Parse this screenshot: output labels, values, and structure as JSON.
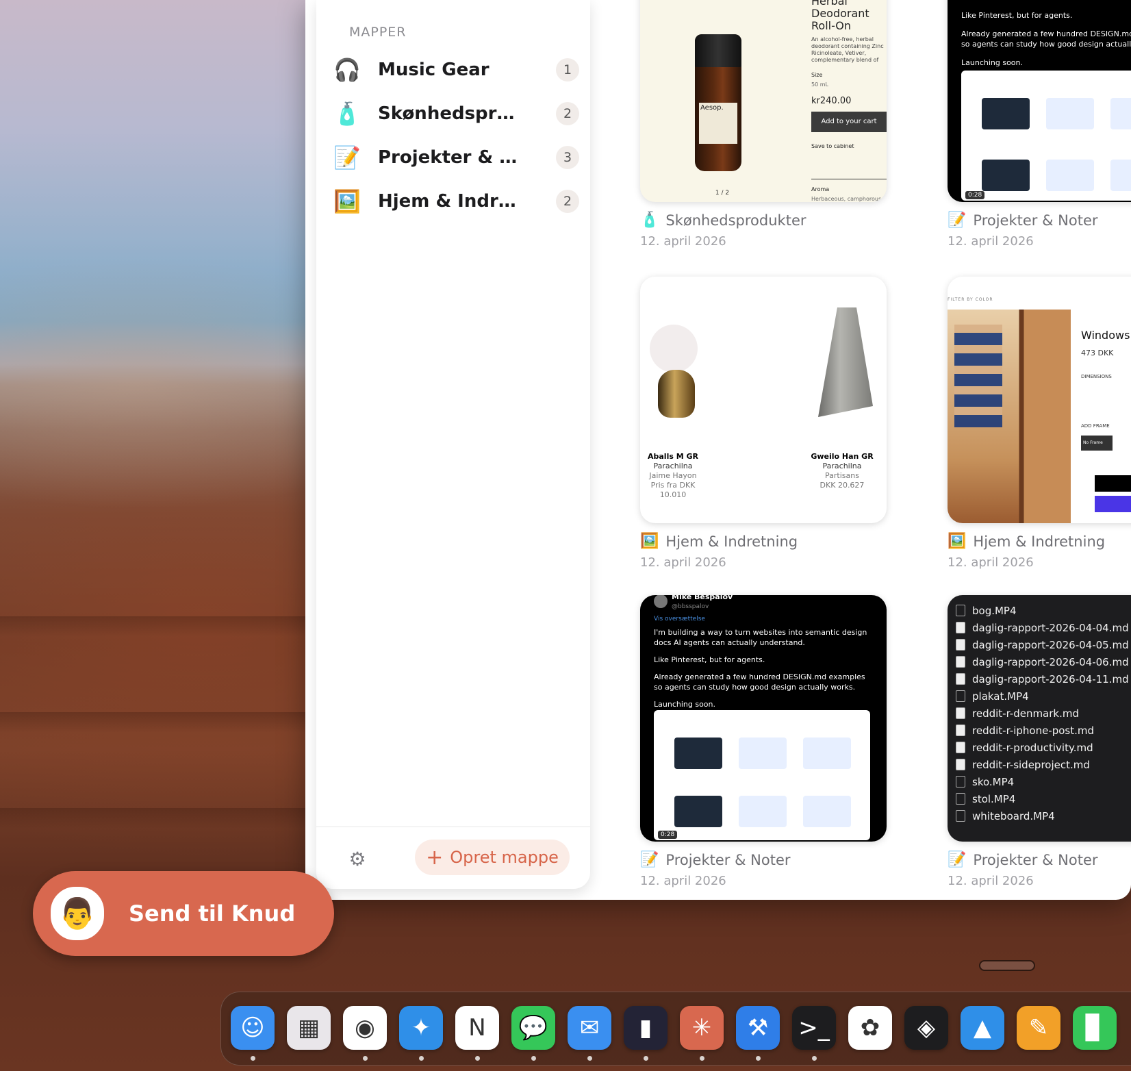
{
  "sidebar": {
    "section_title": "MAPPER",
    "folders": [
      {
        "name": "Music Gear",
        "count": "1",
        "icon": "🎧"
      },
      {
        "name": "Skønhedsprodukter",
        "count": "2",
        "icon": "🧴"
      },
      {
        "name": "Projekter & Noter",
        "count": "3",
        "icon": "📝"
      },
      {
        "name": "Hjem & Indretning",
        "count": "2",
        "icon": "🖼️"
      }
    ],
    "settings_icon": "⚙",
    "create_label": "Opret mappe",
    "create_plus": "+"
  },
  "cards": [
    {
      "folder": "Skønhedsprodukter",
      "icon": "🧴",
      "date": "12. april 2026",
      "thumb": {
        "heading": "Herbal Deodorant Roll-On",
        "desc": "An alcohol-free, herbal deodorant containing Zinc Ricinoleate, Vetiver, complementary blend of essential deodorisers online.",
        "size_label": "Size",
        "size": "50 mL",
        "price": "kr240.00",
        "button": "Add to your cart",
        "save": "Save to cabinet",
        "pager": "1 / 2",
        "aroma_label": "Aroma",
        "aroma": "Herbaceous, camphorous, fresh",
        "brand": "Aesop."
      }
    },
    {
      "folder": "Projekter & Noter",
      "icon": "📝",
      "date": "12. april 2026",
      "thumb": {
        "line1": "Like Pinterest, but for agents.",
        "line2": "Already generated a few hundred DESIGN.md examples so agents can study how good design actually works.",
        "line3": "Launching soon.",
        "duration": "0:28"
      }
    },
    {
      "folder": "Hjem & Indretning",
      "icon": "🖼️",
      "date": "12. april 2026",
      "thumb": {
        "p1_name": "Aballs M GR",
        "p1_brand": "Parachilna",
        "p1_designer": "Jaime Hayon",
        "p1_price": "Pris fra DKK 10.010",
        "p2_name": "Gweilo Han GR",
        "p2_brand": "Parachilna",
        "p2_designer": "Partisans",
        "p2_price": "DKK 20.627"
      }
    },
    {
      "folder": "Hjem & Indretning",
      "icon": "🖼️",
      "date": "12. april 2026",
      "thumb": {
        "title": "Windows",
        "price": "473 DKK",
        "dimensions": "DIMENSIONS",
        "frame": "ADD FRAME",
        "no_frame": "No Frame",
        "filter": "FILTER BY COLOR"
      }
    },
    {
      "folder": "Projekter & Noter",
      "icon": "📝",
      "date": "12. april 2026",
      "thumb": {
        "author": "Mike Bespalov",
        "handle": "@bbsspalov",
        "translate": "Vis oversættelse",
        "p1": "I'm building a way to turn websites into semantic design docs AI agents can actually understand.",
        "p2": "Like Pinterest, but for agents.",
        "p3": "Already generated a few hundred DESIGN.md examples so agents can study how good design actually works.",
        "p4": "Launching soon.",
        "duration": "0:28"
      }
    },
    {
      "folder": "Projekter & Noter",
      "icon": "📝",
      "date": "12. april 2026",
      "thumb": {
        "files": [
          {
            "name": "bog.MP4",
            "type": "video"
          },
          {
            "name": "daglig-rapport-2026-04-04.md",
            "type": "doc"
          },
          {
            "name": "daglig-rapport-2026-04-05.md",
            "type": "doc"
          },
          {
            "name": "daglig-rapport-2026-04-06.md",
            "type": "doc"
          },
          {
            "name": "daglig-rapport-2026-04-11.md",
            "type": "doc"
          },
          {
            "name": "plakat.MP4",
            "type": "video"
          },
          {
            "name": "reddit-r-denmark.md",
            "type": "doc"
          },
          {
            "name": "reddit-r-iphone-post.md",
            "type": "doc"
          },
          {
            "name": "reddit-r-productivity.md",
            "type": "doc"
          },
          {
            "name": "reddit-r-sideproject.md",
            "type": "doc"
          },
          {
            "name": "sko.MP4",
            "type": "video"
          },
          {
            "name": "stol.MP4",
            "type": "video"
          },
          {
            "name": "whiteboard.MP4",
            "type": "video"
          }
        ]
      }
    }
  ],
  "send": {
    "label": "Send til Knud",
    "avatar": "👨"
  },
  "dock": [
    {
      "name": "finder",
      "glyph": "☺",
      "color": "#3a8ff0",
      "dot": true
    },
    {
      "name": "launchpad",
      "glyph": "▦",
      "color": "#e9e6ea",
      "dot": false
    },
    {
      "name": "chrome",
      "glyph": "◉",
      "color": "#ffffff",
      "dot": true
    },
    {
      "name": "safari",
      "glyph": "✦",
      "color": "#2f8fe8",
      "dot": true
    },
    {
      "name": "notion",
      "glyph": "N",
      "color": "#ffffff",
      "dot": true
    },
    {
      "name": "messages",
      "glyph": "💬",
      "color": "#35c759",
      "dot": true
    },
    {
      "name": "mail",
      "glyph": "✉",
      "color": "#3a8ff0",
      "dot": true
    },
    {
      "name": "audio",
      "glyph": "▮",
      "color": "#232336",
      "dot": true
    },
    {
      "name": "claude",
      "glyph": "✳",
      "color": "#d8684f",
      "dot": true
    },
    {
      "name": "xcode",
      "glyph": "⚒",
      "color": "#2f7ee8",
      "dot": true
    },
    {
      "name": "terminal",
      "glyph": ">_",
      "color": "#1d1d1f",
      "dot": true
    },
    {
      "name": "photos",
      "glyph": "✿",
      "color": "#ffffff",
      "dot": false
    },
    {
      "name": "figma",
      "glyph": "◈",
      "color": "#1d1d1f",
      "dot": false
    },
    {
      "name": "keynote",
      "glyph": "▲",
      "color": "#2f8fe8",
      "dot": false
    },
    {
      "name": "pages",
      "glyph": "✎",
      "color": "#f2a028",
      "dot": false
    },
    {
      "name": "numbers",
      "glyph": "▊",
      "color": "#35c759",
      "dot": false
    }
  ]
}
